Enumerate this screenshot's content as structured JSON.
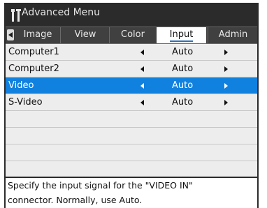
{
  "window": {
    "title": "Advanced Menu",
    "icon": "tools-icon"
  },
  "tabs": [
    {
      "label": "Image",
      "active": false
    },
    {
      "label": "View",
      "active": false
    },
    {
      "label": "Color",
      "active": false
    },
    {
      "label": "Input",
      "active": true
    },
    {
      "label": "Admin",
      "active": false
    }
  ],
  "rows": [
    {
      "label": "Computer1",
      "value": "Auto",
      "selected": false
    },
    {
      "label": "Computer2",
      "value": "Auto",
      "selected": false
    },
    {
      "label": "Video",
      "value": "Auto",
      "selected": true
    },
    {
      "label": "S-Video",
      "value": "Auto",
      "selected": false
    }
  ],
  "help": {
    "line1": "Specify the input signal for the \"VIDEO IN\"",
    "line2": "connector. Normally, use Auto."
  },
  "colors": {
    "selection": "#1181e0",
    "background": "#2b2b2b",
    "tab_underline": "#2d6fb3"
  }
}
